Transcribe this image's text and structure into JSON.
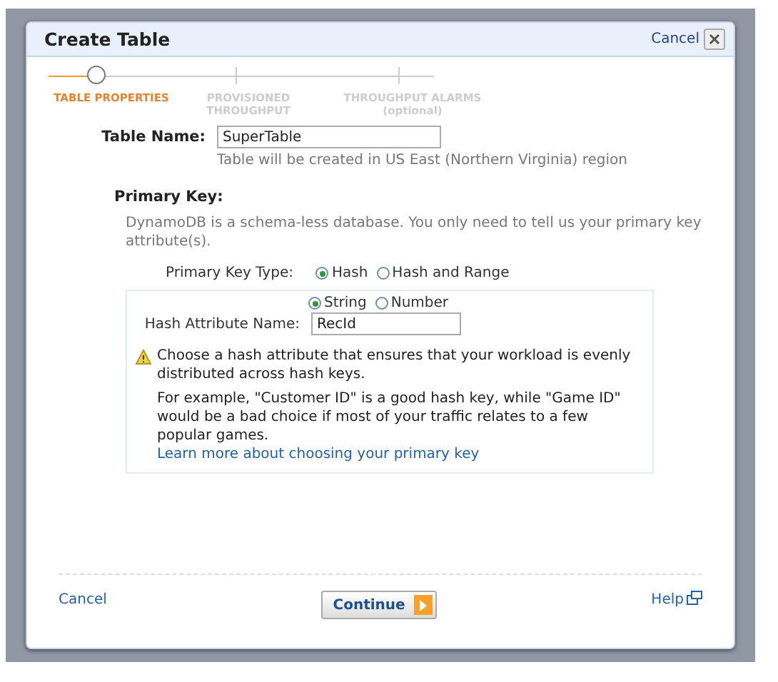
{
  "dialog": {
    "title": "Create Table",
    "cancel_link": "Cancel"
  },
  "steps": [
    {
      "label": "TABLE PROPERTIES",
      "selected": true
    },
    {
      "label": "PROVISIONED THROUGHPUT",
      "selected": false
    },
    {
      "label": "THROUGHPUT ALARMS",
      "note": "(optional)",
      "selected": false
    }
  ],
  "table_name": {
    "label": "Table Name:",
    "value": "SuperTable",
    "hint": "Table will be created in US East (Northern Virginia) region"
  },
  "primary_key": {
    "heading": "Primary Key:",
    "description": "DynamoDB is a schema-less database. You only need to tell us your primary key attribute(s).",
    "type_label": "Primary Key Type:",
    "types": [
      {
        "label": "Hash",
        "selected": true
      },
      {
        "label": "Hash and Range",
        "selected": false
      }
    ],
    "attribute_types": [
      {
        "label": "String",
        "selected": true
      },
      {
        "label": "Number",
        "selected": false
      }
    ],
    "attribute_label": "Hash Attribute Name:",
    "attribute_value": "RecId",
    "warning": "Choose a hash attribute that ensures that your workload is evenly distributed across hash keys.",
    "example": "For example, \"Customer ID\" is a good hash key, while \"Game ID\" would be a bad choice if most of your traffic relates to a few popular games.",
    "learn_more": "Learn more about choosing your primary key"
  },
  "footer": {
    "cancel": "Cancel",
    "continue": "Continue",
    "help": "Help"
  }
}
